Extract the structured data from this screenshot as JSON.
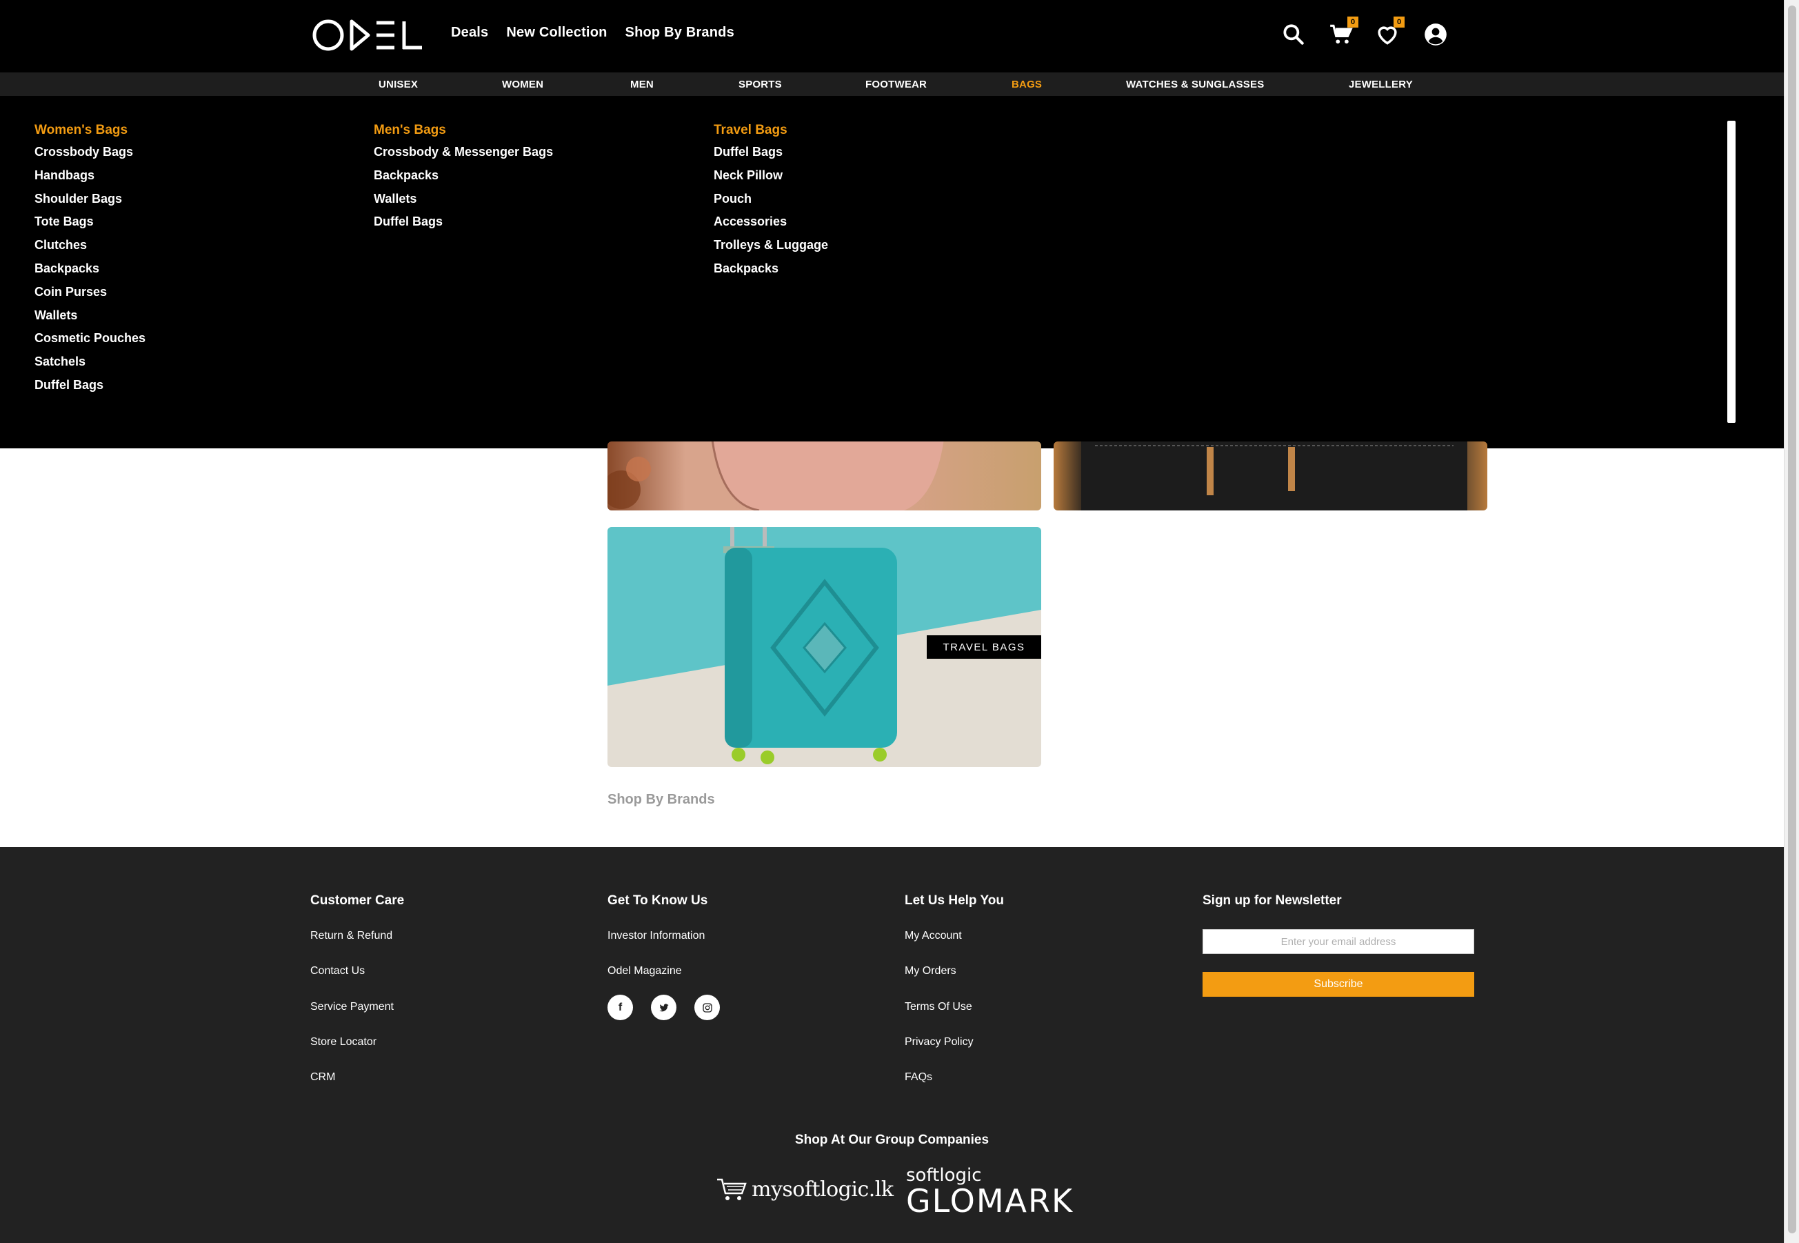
{
  "header": {
    "logo_text": "ODEL",
    "nav": [
      "Deals",
      "New Collection",
      "Shop By Brands"
    ],
    "cart_count": "0",
    "wishlist_count": "0",
    "icons": [
      "search-icon",
      "cart-icon",
      "heart-icon",
      "account-icon"
    ]
  },
  "categories": [
    "UNISEX",
    "WOMEN",
    "MEN",
    "SPORTS",
    "FOOTWEAR",
    "BAGS",
    "WATCHES & SUNGLASSES",
    "JEWELLERY"
  ],
  "active_category": "BAGS",
  "mega_menu": {
    "columns": [
      {
        "heading": "Women's Bags",
        "items": [
          "Crossbody Bags",
          "Handbags",
          "Shoulder Bags",
          "Tote Bags",
          "Clutches",
          "Backpacks",
          "Coin Purses",
          "Wallets",
          "Cosmetic Pouches",
          "Satchels",
          "Duffel Bags"
        ]
      },
      {
        "heading": "Men's Bags",
        "items": [
          "Crossbody & Messenger Bags",
          "Backpacks",
          "Wallets",
          "Duffel Bags"
        ]
      },
      {
        "heading": "Travel Bags",
        "items": [
          "Duffel Bags",
          "Neck Pillow",
          "Pouch",
          "Accessories",
          "Trolleys & Luggage",
          "Backpacks"
        ]
      }
    ]
  },
  "banners": {
    "travel_label": "TRAVEL BAGS"
  },
  "shop_by_brands": "Shop By Brands",
  "footer": {
    "customer_care": {
      "heading": "Customer Care",
      "links": [
        "Return & Refund",
        "Contact Us",
        "Service Payment",
        "Store Locator",
        "CRM"
      ]
    },
    "get_to_know": {
      "heading": "Get To Know Us",
      "links": [
        "Investor Information",
        "Odel Magazine"
      ]
    },
    "help": {
      "heading": "Let Us Help You",
      "links": [
        "My Account",
        "My Orders",
        "Terms Of Use",
        "Privacy Policy",
        "FAQs"
      ]
    },
    "newsletter": {
      "heading": "Sign up for Newsletter",
      "placeholder": "Enter your email address",
      "button": "Subscribe"
    },
    "group_title": "Shop At Our Group Companies",
    "group_logos": {
      "mysoftlogic": "mysoftlogic.lk",
      "glomark_small": "softlogic",
      "glomark_big": "GLOMARK"
    }
  },
  "colors": {
    "accent": "#f39c12",
    "header_bg": "#000000",
    "catbar_bg": "#1e1e1e",
    "footer_bg": "#222222"
  }
}
